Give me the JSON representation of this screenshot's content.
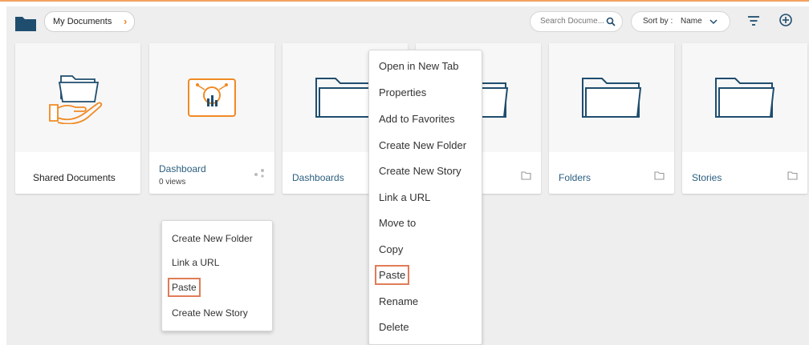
{
  "breadcrumb": {
    "label": "My Documents"
  },
  "toolbar": {
    "search_placeholder": "Search Docume...",
    "sort_label": "Sort by :",
    "sort_value": "Name",
    "accent_color": "#f4a261"
  },
  "cards": [
    {
      "title": "Shared Documents",
      "icon": "shared-folder-hand-icon"
    },
    {
      "title": "Dashboard",
      "subtitle": "0 views",
      "icon": "dashboard-chart-icon",
      "corner_icon": "share-icon"
    },
    {
      "title": "Dashboards",
      "icon": "folder-icon",
      "corner_icon": "folder-icon"
    },
    {
      "title": "",
      "icon": "folder-icon",
      "corner_icon": "folder-icon"
    },
    {
      "title": "Folders",
      "icon": "folder-icon",
      "corner_icon": "folder-icon"
    },
    {
      "title": "Stories",
      "icon": "folder-icon",
      "corner_icon": "folder-icon"
    }
  ],
  "context_menu": {
    "items": [
      "Open in New Tab",
      "Properties",
      "Add to Favorites",
      "Create New Folder",
      "Create New Story",
      "Link a URL",
      "Move to",
      "Copy",
      "Paste",
      "Rename",
      "Delete"
    ],
    "highlighted": "Paste"
  },
  "blank_menu": {
    "items": [
      "Create New Folder",
      "Link a URL",
      "Paste",
      "Create New Story"
    ],
    "highlighted": "Paste"
  }
}
